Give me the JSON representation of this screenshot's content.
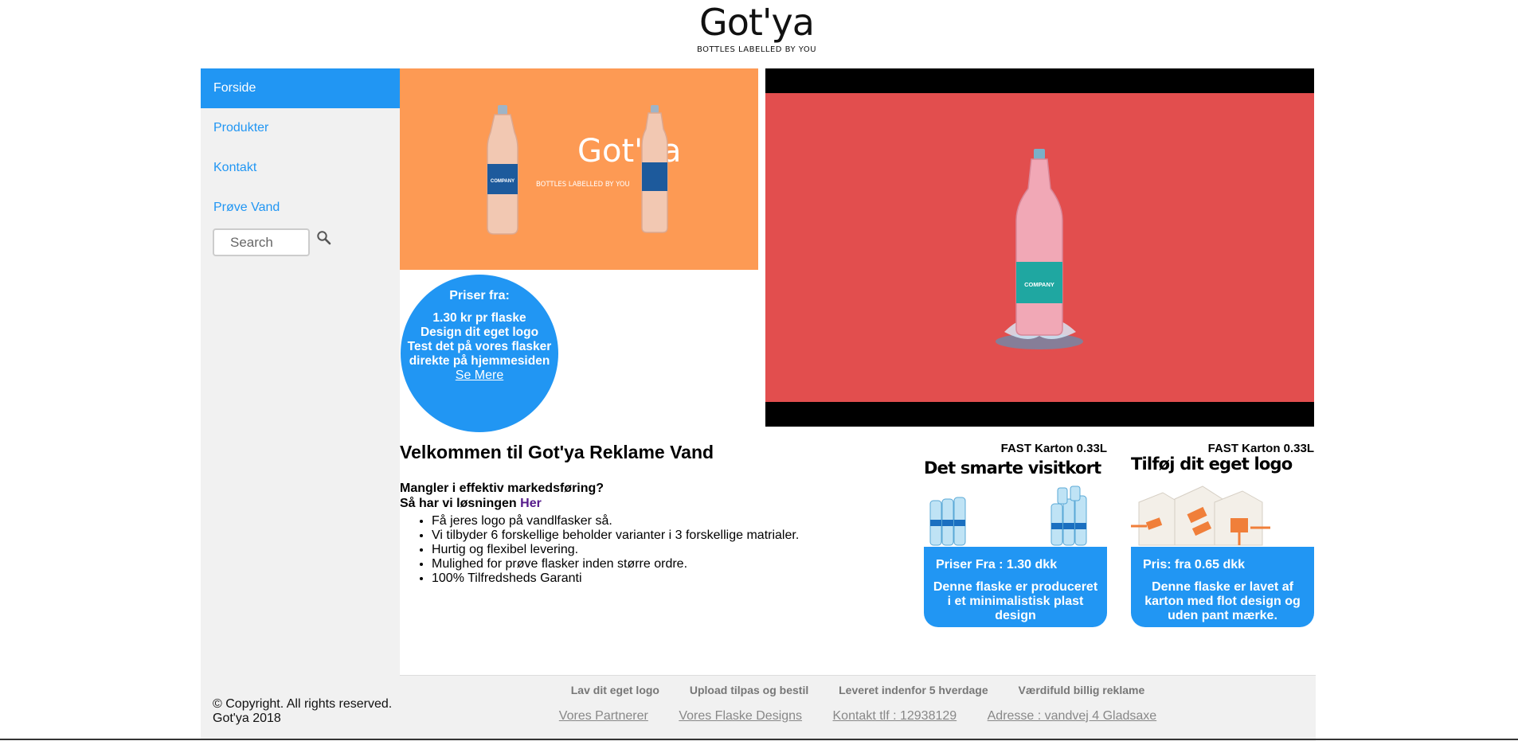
{
  "header": {
    "brand": "Got'ya",
    "tagline": "BOTTLES LABELLED BY YOU"
  },
  "sidebar": {
    "items": [
      {
        "label": "Forside"
      },
      {
        "label": "Produkter"
      },
      {
        "label": "Kontakt"
      },
      {
        "label": "Prøve Vand"
      }
    ],
    "search_placeholder": "Search",
    "copyright_line1": "© Copyright. All rights reserved.",
    "copyright_line2": "Got'ya 2018"
  },
  "hero": {
    "brand": "Got'ya",
    "tagline": "BOTTLES LABELLED BY YOU",
    "bottle_label": "COMPANY",
    "video_bottle_label": "COMPANY"
  },
  "price_circle": {
    "heading": "Priser fra:",
    "line1": "1.30 kr pr flaske",
    "line2": "Design dit eget logo",
    "line3": "Test det på vores flasker",
    "line4": "direkte på hjemmesiden",
    "link": "Se Mere"
  },
  "welcome": {
    "title": "Velkommen til Got'ya Reklame Vand",
    "question": "Mangler i effektiv markedsføring?",
    "solution_prefix": "Så har vi løsningen",
    "solution_link": "Her",
    "bullets": [
      "Få jeres logo på vandlfasker så.",
      "Vi tilbyder 6 forskellige beholder varianter i 3 forskellige matrialer.",
      "Hurtig og flexibel levering.",
      "Mulighed for prøve flasker inden større ordre.",
      "100% Tilfredsheds Garanti"
    ]
  },
  "cards": [
    {
      "title": "FAST Karton 0.33L",
      "slogan": "Det smarte visitkort",
      "price": "Priser Fra : 1.30 dkk",
      "description": "Denne flaske er produceret i et minimalistisk plast design"
    },
    {
      "title": "FAST Karton 0.33L",
      "slogan": "Tilføj dit eget logo",
      "price": "Pris: fra 0.65 dkk",
      "description": "Denne flaske er lavet af karton med flot design og uden pant mærke."
    }
  ],
  "footer": {
    "labels": [
      "Lav dit eget logo",
      "Upload tilpas og bestil",
      "Leveret indenfor 5 hverdage",
      "Værdifuld billig reklame"
    ],
    "links": [
      "Vores Partnerer",
      "Vores Flaske Designs",
      "Kontakt tlf : 12938129",
      "Adresse : vandvej 4 Gladsaxe"
    ]
  },
  "colors": {
    "accent": "#2196f3",
    "hero_orange": "#fd9a54",
    "video_red": "#e24e4e",
    "sidebar_bg": "#f1f1f1"
  }
}
